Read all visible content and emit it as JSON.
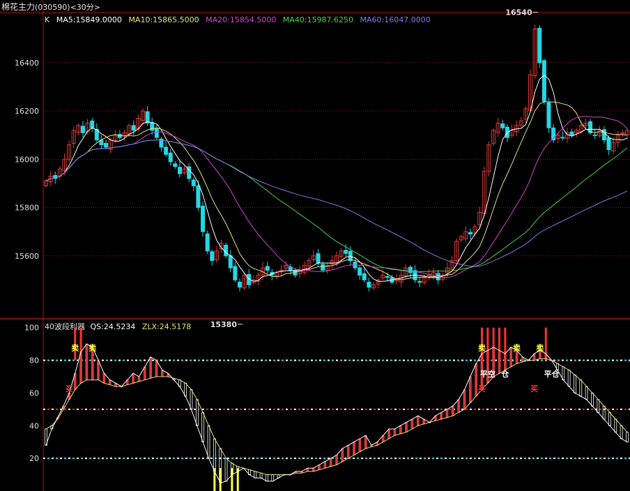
{
  "window": {
    "name": "棉花主力",
    "code": "(030590)",
    "period": "<30分>"
  },
  "colors": {
    "background": "#000000",
    "border": "#b01010",
    "grid": "#8a1a1a",
    "axis_text": "#e0e0e0",
    "up": "#d83a3a",
    "down": "#22d8e6",
    "ma5": "#ffffff",
    "ma10": "#e6e27a",
    "ma20": "#d246d2",
    "ma40": "#46d246",
    "ma60": "#7a7ae6",
    "qs": "#ffffff",
    "zlx": "#e6e27a",
    "ref_cyan": "#38d8e8",
    "ref_red": "#e03030",
    "signal_yellow": "#ffff40",
    "signal_red": "#ff3030"
  },
  "chart_data": [
    {
      "type": "candlestick",
      "label": "K",
      "legend": [
        {
          "key": "ma5",
          "text": "MA5:15849.0000"
        },
        {
          "key": "ma10",
          "text": "MA10:15865.5000"
        },
        {
          "key": "ma20",
          "text": "MA20:15854.5000"
        },
        {
          "key": "ma40",
          "text": "MA40:15987.6250"
        },
        {
          "key": "ma60",
          "text": "MA60:16047.0000"
        }
      ],
      "y_ticks": [
        15600,
        15800,
        16000,
        16200,
        16400
      ],
      "ylim": [
        15345,
        16605
      ],
      "high_annotation": {
        "value": 16540,
        "text": "16540"
      },
      "low_annotation": {
        "value": 15380,
        "text": "15380"
      },
      "closes": [
        15910,
        15930,
        15920,
        15960,
        16000,
        16060,
        16120,
        16140,
        16110,
        16150,
        16130,
        16080,
        16060,
        16050,
        16080,
        16100,
        16090,
        16110,
        16140,
        16120,
        16170,
        16200,
        16150,
        16120,
        16090,
        16050,
        16020,
        15990,
        15970,
        15940,
        15960,
        15920,
        15890,
        15800,
        15700,
        15620,
        15580,
        15620,
        15650,
        15600,
        15550,
        15500,
        15470,
        15520,
        15480,
        15500,
        15520,
        15550,
        15540,
        15520,
        15530,
        15540,
        15560,
        15540,
        15520,
        15540,
        15560,
        15580,
        15600,
        15570,
        15540,
        15560,
        15580,
        15600,
        15620,
        15610,
        15580,
        15550,
        15520,
        15500,
        15470,
        15480,
        15500,
        15520,
        15510,
        15490,
        15500,
        15520,
        15550,
        15530,
        15500,
        15490,
        15510,
        15520,
        15530,
        15500,
        15520,
        15550,
        15580,
        15660,
        15680,
        15700,
        15690,
        15720,
        15780,
        15950,
        16060,
        16120,
        16150,
        16130,
        16090,
        16120,
        16140,
        16160,
        16210,
        16350,
        16540,
        16400,
        16240,
        16130,
        16080,
        16100,
        16090,
        16110,
        16100,
        16120,
        16140,
        16150,
        16110,
        16100,
        16120,
        16080,
        16040,
        16070,
        16100,
        16110,
        16120
      ]
    },
    {
      "type": "line",
      "title": "40波段利器",
      "legend": [
        {
          "key": "qs",
          "text": "QS:24.5234"
        },
        {
          "key": "zlx",
          "text": "ZLX:24.5178"
        }
      ],
      "y_ticks": [
        20,
        40,
        60,
        80,
        100
      ],
      "ylim": [
        0,
        105
      ],
      "reference_lines": [
        {
          "value": 80,
          "color": "ref_cyan"
        },
        {
          "value": 50,
          "color": "ref_red"
        },
        {
          "value": 20,
          "color": "ref_cyan"
        }
      ],
      "qs": [
        28,
        38,
        45,
        52,
        60,
        72,
        85,
        90,
        88,
        80,
        72,
        68,
        66,
        64,
        68,
        72,
        70,
        76,
        82,
        80,
        74,
        72,
        68,
        64,
        58,
        50,
        40,
        30,
        20,
        12,
        5,
        6,
        10,
        12,
        14,
        10,
        8,
        8,
        6,
        6,
        8,
        10,
        10,
        12,
        12,
        14,
        14,
        16,
        18,
        20,
        22,
        26,
        28,
        30,
        32,
        34,
        28,
        30,
        34,
        38,
        38,
        40,
        42,
        44,
        46,
        44,
        42,
        46,
        48,
        50,
        52,
        56,
        62,
        70,
        78,
        84,
        86,
        88,
        86,
        84,
        88,
        86,
        82,
        80,
        84,
        86,
        84,
        80,
        74,
        68,
        64,
        60,
        58,
        56,
        52,
        48,
        44,
        40,
        36,
        32,
        30
      ],
      "zlx": [
        38,
        40,
        44,
        50,
        56,
        62,
        66,
        68,
        68,
        68,
        66,
        65,
        64,
        64,
        65,
        66,
        67,
        68,
        69,
        70,
        70,
        70,
        69,
        68,
        66,
        62,
        56,
        48,
        40,
        32,
        26,
        20,
        17,
        15,
        14,
        13,
        12,
        11,
        10,
        10,
        10,
        10,
        10,
        11,
        11,
        12,
        12,
        13,
        14,
        15,
        16,
        18,
        20,
        22,
        24,
        26,
        27,
        28,
        30,
        32,
        34,
        35,
        36,
        38,
        40,
        41,
        42,
        43,
        44,
        45,
        46,
        48,
        50,
        54,
        58,
        62,
        66,
        70,
        72,
        74,
        76,
        78,
        79,
        80,
        80,
        81,
        81,
        80,
        78,
        76,
        74,
        71,
        68,
        64,
        60,
        56,
        52,
        48,
        44,
        40,
        36
      ],
      "signals": [
        {
          "text": "买",
          "color": "signal_red",
          "x_index": 4,
          "value": 61
        },
        {
          "text": "卖",
          "color": "signal_yellow",
          "x_index": 5,
          "value": 86
        },
        {
          "text": "卖",
          "color": "signal_yellow",
          "x_index": 8,
          "value": 86
        },
        {
          "text": "买",
          "color": "signal_red",
          "x_index": 75,
          "value": 61
        },
        {
          "text": "卖",
          "color": "signal_yellow",
          "x_index": 75,
          "value": 86
        },
        {
          "text": "平空",
          "color": "signal_white",
          "x_index": 76,
          "value": 70
        },
        {
          "text": "仓",
          "color": "signal_white",
          "x_index": 79,
          "value": 70
        },
        {
          "text": "平仓",
          "color": "signal_white",
          "x_index": 87,
          "value": 70
        },
        {
          "text": "卖",
          "color": "signal_yellow",
          "x_index": 85,
          "value": 86
        },
        {
          "text": "买",
          "color": "signal_red",
          "x_index": 84,
          "value": 61
        },
        {
          "text": "卖",
          "color": "signal_yellow",
          "x_index": 81,
          "value": 86
        }
      ],
      "red_spikes": [
        5,
        6,
        75,
        76,
        77,
        78,
        79,
        86
      ],
      "yellow_spikes": [
        29,
        30,
        32,
        33
      ]
    }
  ]
}
